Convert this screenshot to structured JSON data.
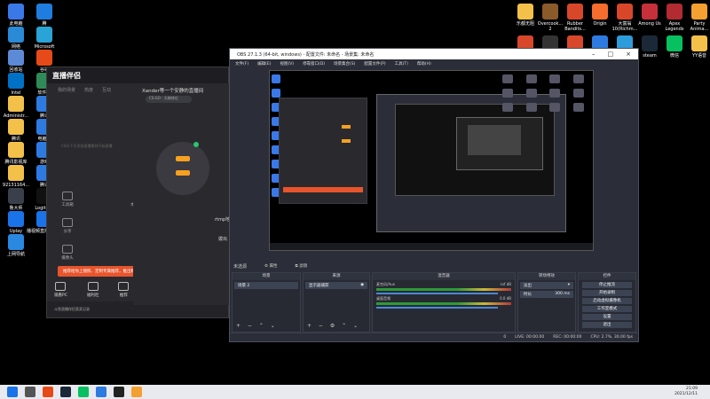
{
  "desktop": {
    "left_icons": [
      {
        "label": "此电脑",
        "color": "#3b78e7"
      },
      {
        "label": "腾",
        "color": "#1f7de0"
      },
      {
        "label": "网络",
        "color": "#2a8ad6"
      },
      {
        "label": "Microsoft\nEdge",
        "color": "#2aa3d6"
      },
      {
        "label": "回收站",
        "color": "#5c8ad6"
      },
      {
        "label": "谷歌",
        "color": "#e64a19"
      },
      {
        "label": "Intel",
        "color": "#0071c5"
      },
      {
        "label": "软件管",
        "color": "#2e8b57"
      },
      {
        "label": "Administr...",
        "color": "#f3c04a"
      },
      {
        "label": "腾讯",
        "color": "#2d7be0"
      },
      {
        "label": "腾讯",
        "color": "#f3c04a"
      },
      {
        "label": "电脑管",
        "color": "#2d7be0"
      },
      {
        "label": "腾讯影视库",
        "color": "#f3c04a"
      },
      {
        "label": "游戏",
        "color": "#2d7be0"
      },
      {
        "label": "92131164...",
        "color": "#f3c04a"
      },
      {
        "label": "腾讯",
        "color": "#2d7be0"
      },
      {
        "label": "鲁大师",
        "color": "#3a3f4b"
      },
      {
        "label": "Logitech\nHUB",
        "color": "#111"
      },
      {
        "label": "Uplay",
        "color": "#1a73e8"
      },
      {
        "label": "播视频直播源浏览",
        "color": "#1a73e8"
      },
      {
        "label": "上网导航",
        "color": "#2a88e0"
      }
    ],
    "right_icons": [
      {
        "label": "乐都无阻",
        "color": "#f3c04a"
      },
      {
        "label": "Overcook...\n2",
        "color": "#8b5a2b"
      },
      {
        "label": "Rubber\nBandits...",
        "color": "#d9472b"
      },
      {
        "label": "Origin",
        "color": "#f56c2d"
      },
      {
        "label": "大富翁\n10(Richm...",
        "color": "#d9472b"
      },
      {
        "label": "Among Us",
        "color": "#c5303a"
      },
      {
        "label": "Apex\nLegends",
        "color": "#b12b30"
      },
      {
        "label": "Party\nAnima...",
        "color": "#f3a030"
      },
      {
        "label": "Rubber\nBandits...",
        "color": "#d9472b"
      },
      {
        "label": "BS抗损手机",
        "color": "#333"
      },
      {
        "label": "5E对战平台",
        "color": "#d9472b"
      },
      {
        "label": "腾讯网游加速器",
        "color": "#2d7be0"
      },
      {
        "label": "网易UU加速器",
        "color": "#2d9cdb"
      },
      {
        "label": "steam",
        "color": "#1b2838"
      },
      {
        "label": "微信",
        "color": "#07c160"
      },
      {
        "label": "YY语音",
        "color": "#f3c04a"
      },
      {
        "label": "斗鱼直播伴侣",
        "color": "#f56c2d"
      },
      {
        "label": "虎牙直播",
        "color": "#f3a030"
      },
      {
        "label": "QQ游戏",
        "color": "#2d9cdb"
      },
      {
        "label": "QQ音乐",
        "color": "#31c27c"
      }
    ]
  },
  "streaming_app": {
    "logo": "直播伴侣",
    "tabs": [
      "我的场景",
      "热度",
      "互动"
    ],
    "empty_hint": "Click下方添加直播素材开始直播",
    "title": "Xander等一个安静的直播间",
    "badge": "CS:GO · 天梯排位",
    "tools": [
      [
        "工具箱",
        "本场直播",
        "直播间"
      ],
      [
        "分享",
        "游戏",
        "录制"
      ],
      [
        "摄像头",
        "截图",
        "投屏"
      ]
    ],
    "banner": "推荐给你上镜照、定制专属推荐，推出精彩高光片段",
    "nav": [
      "观看PC",
      "福利社",
      "推荐"
    ],
    "foot": "斗鱼直播伴侣获奖记录",
    "side_text_1": "rtmp地",
    "side_text_2": "拨出"
  },
  "obs": {
    "title": "OBS 27.1.3 (64-bit, windows) - 配置文件: 未命名 - 场景集: 未命名",
    "menu": [
      "文件(F)",
      "编辑(E)",
      "视图(V)",
      "停靠窗口(D)",
      "场景集合(S)",
      "配置文件(P)",
      "工具(T)",
      "帮助(H)"
    ],
    "source_bar_label": "未选源",
    "source_bar_buttons": [
      "属性",
      "滤镜"
    ],
    "docks": {
      "scenes": {
        "header": "场景",
        "items": [
          "场景 2"
        ]
      },
      "sources": {
        "header": "来源",
        "items": [
          "显示器捕获"
        ]
      },
      "mixer": {
        "header": "混音器",
        "tracks": [
          {
            "name": "麦克风/Aux",
            "db": "-inf dB"
          },
          {
            "name": "桌面音频",
            "db": "0.0 dB"
          }
        ]
      },
      "transitions": {
        "header": "转场特效",
        "mode": "淡出",
        "duration_label": "时长",
        "duration": "300 ms"
      },
      "controls": {
        "header": "控件",
        "buttons": [
          "停止推流",
          "开始录制",
          "启动虚拟摄像机",
          "工作室模式",
          "设置",
          "退出"
        ]
      }
    },
    "status": {
      "dropped": "0",
      "live": "LIVE: 00:00:00",
      "rec": "REC: 00:00:00",
      "cpu": "CPU: 2.7%, 30.00 fps"
    }
  },
  "taskbar": {
    "time": "21:09",
    "date": "2021/12/11"
  }
}
